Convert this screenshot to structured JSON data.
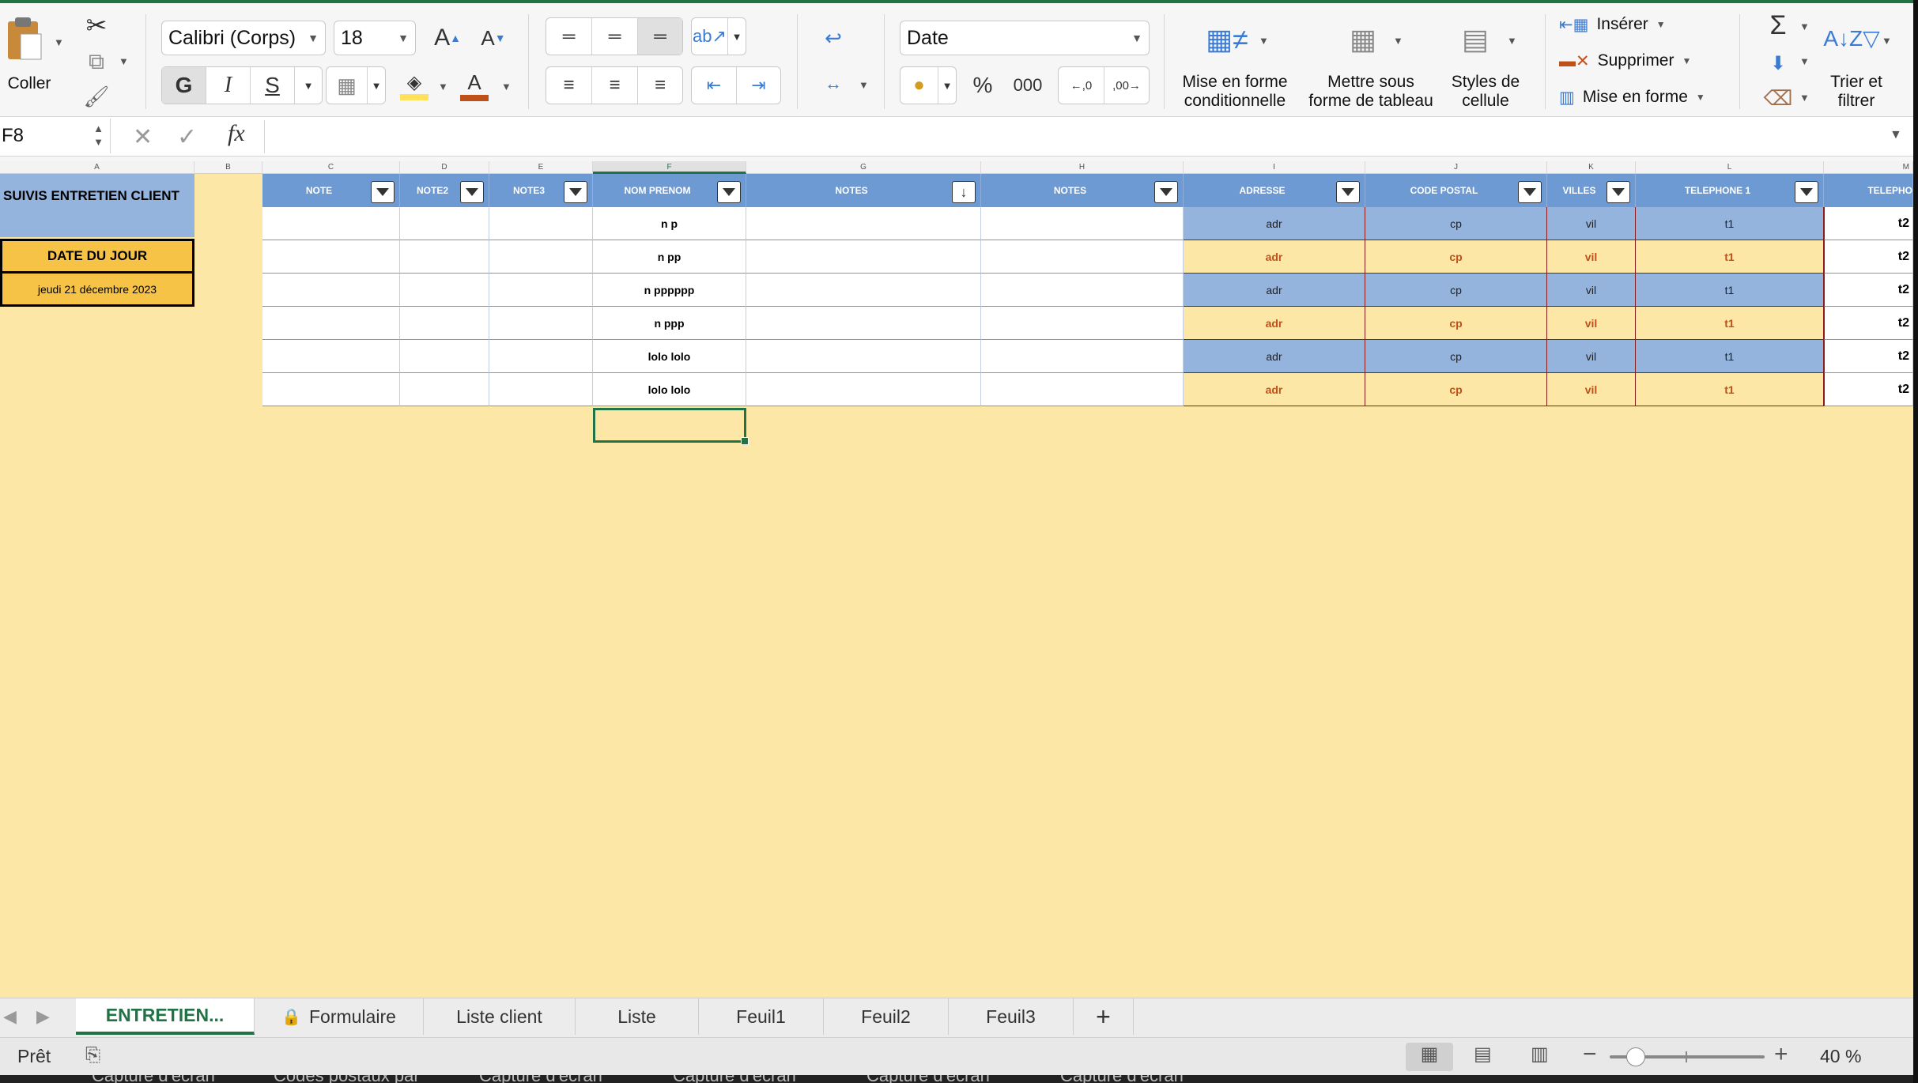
{
  "ribbon": {
    "paste_label": "Coller",
    "font_name": "Calibri (Corps)",
    "font_size": "18",
    "bold": "G",
    "italic": "I",
    "underline": "S",
    "number_format": "Date",
    "percent": "%",
    "thousands": "000",
    "cond_format": [
      "Mise en forme",
      "conditionnelle"
    ],
    "format_table": [
      "Mettre sous",
      "forme de tableau"
    ],
    "cell_styles": [
      "Styles de",
      "cellule"
    ],
    "insert": "Insérer",
    "delete": "Supprimer",
    "format": "Mise en forme",
    "sort_filter": [
      "Trier et",
      "filtrer"
    ]
  },
  "formula_bar": {
    "name_box": "F8",
    "fx": "fx",
    "content": ""
  },
  "columns": [
    "A",
    "B",
    "C",
    "D",
    "E",
    "F",
    "G",
    "H",
    "I",
    "J",
    "K",
    "L",
    "M"
  ],
  "sheet": {
    "title": "SUIVIS ENTRETIEN CLIENT",
    "date_label": "DATE DU JOUR",
    "date_value": "jeudi 21 décembre 2023",
    "headers": [
      "NOTE",
      "NOTE2",
      "NOTE3",
      "NOM PRENOM",
      "NOTES",
      "NOTES",
      "ADRESSE",
      "CODE POSTAL",
      "VILLES",
      "TELEPHONE 1",
      "TELEPHO"
    ],
    "rows": [
      {
        "nom": "n p",
        "adresse": "adr",
        "cp": "cp",
        "ville": "vil",
        "tel1": "t1",
        "tel2": "t2"
      },
      {
        "nom": "n pp",
        "adresse": "adr",
        "cp": "cp",
        "ville": "vil",
        "tel1": "t1",
        "tel2": "t2"
      },
      {
        "nom": "n pppppp",
        "adresse": "adr",
        "cp": "cp",
        "ville": "vil",
        "tel1": "t1",
        "tel2": "t2"
      },
      {
        "nom": "n ppp",
        "adresse": "adr",
        "cp": "cp",
        "ville": "vil",
        "tel1": "t1",
        "tel2": "t2"
      },
      {
        "nom": "lolo lolo",
        "adresse": "adr",
        "cp": "cp",
        "ville": "vil",
        "tel1": "t1",
        "tel2": "t2"
      },
      {
        "nom": "lolo lolo",
        "adresse": "adr",
        "cp": "cp",
        "ville": "vil",
        "tel1": "t1",
        "tel2": "t2"
      }
    ]
  },
  "tabs": [
    "ENTRETIEN...",
    "Formulaire",
    "Liste client",
    "Liste",
    "Feuil1",
    "Feuil2",
    "Feuil3"
  ],
  "status": {
    "ready": "Prêt",
    "zoom": "40 %",
    "zoom_level_percent": 40
  },
  "taskbar": [
    "Capture d'écran",
    "Codes postaux par",
    "Capture d'écran",
    "Capture d'écran",
    "Capture d'écran",
    "Capture d'écran"
  ],
  "colors": {
    "excel_green": "#217346",
    "table_header_blue": "#6e9ad3",
    "band_blue": "#94b3dd",
    "band_gold": "#fde7a6",
    "accent_orange": "#f6c346"
  }
}
